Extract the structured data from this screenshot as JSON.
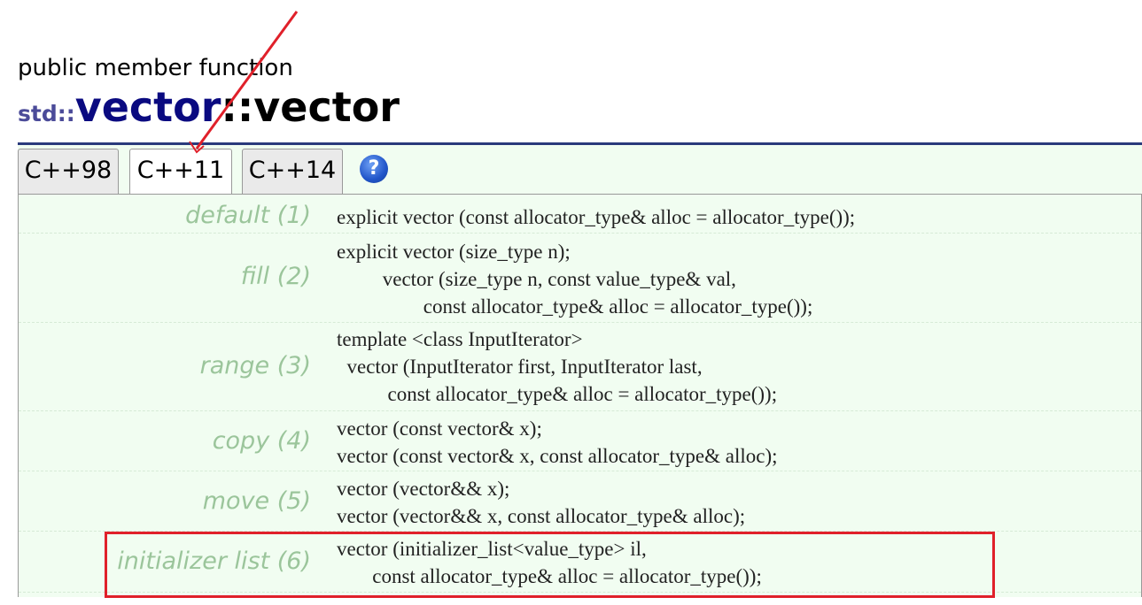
{
  "page": {
    "kind_label": "public member function",
    "title_namespace": "std::",
    "title_class": "vector",
    "title_separator": "::",
    "title_function": "vector"
  },
  "tabs": [
    {
      "label": "C++98",
      "active": false
    },
    {
      "label": "C++11",
      "active": true
    },
    {
      "label": "C++14",
      "active": false
    }
  ],
  "help_icon": {
    "glyph": "?"
  },
  "constructors": [
    {
      "label": "default (1)",
      "code": "explicit vector (const allocator_type& alloc = allocator_type());"
    },
    {
      "label": "fill (2)",
      "code": "explicit vector (size_type n);\n         vector (size_type n, const value_type& val,\n                 const allocator_type& alloc = allocator_type());"
    },
    {
      "label": "range (3)",
      "code": "template <class InputIterator>\n  vector (InputIterator first, InputIterator last,\n          const allocator_type& alloc = allocator_type());"
    },
    {
      "label": "copy (4)",
      "code": "vector (const vector& x);\nvector (const vector& x, const allocator_type& alloc);"
    },
    {
      "label": "move (5)",
      "code": "vector (vector&& x);\nvector (vector&& x, const allocator_type& alloc);"
    },
    {
      "label": "initializer list (6)",
      "code": "vector (initializer_list<value_type> il,\n       const allocator_type& alloc = allocator_type());"
    }
  ],
  "colors": {
    "accent_rule": "#2a3a7c",
    "panel_bg": "#f1fdf1",
    "label_text": "#9bc59b",
    "annotation_red": "#e0202a"
  }
}
